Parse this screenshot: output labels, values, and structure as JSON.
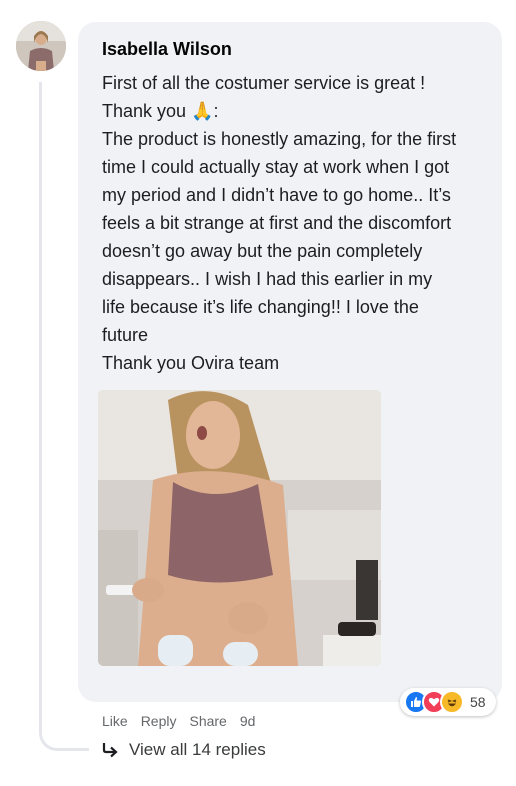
{
  "comment": {
    "author": "Isabella Wilson",
    "lines": [
      "First of all the costumer service is great !",
      "Thank you 🙏:",
      "The product is honestly amazing, for the first",
      "time I could actually stay at work when I got",
      "my period and I didn’t have to go home.. It’s",
      "feels a bit strange at first and the discomfort",
      "doesn’t go away but the pain completely",
      "disappears.. I wish I had this earlier in my",
      "life because it’s life changing!! I love the",
      "future",
      "Thank you Ovira team"
    ]
  },
  "reactions": {
    "icons": [
      "like-icon",
      "love-icon",
      "haha-icon"
    ],
    "count": "58",
    "colors": {
      "like": "#1877f2",
      "love": "#f33e58",
      "haha": "#f7b928"
    }
  },
  "actions": {
    "like": "Like",
    "reply": "Reply",
    "share": "Share",
    "time": "9d"
  },
  "replies": {
    "label": "View all 14 replies",
    "icon": "reply-arrow-icon"
  }
}
